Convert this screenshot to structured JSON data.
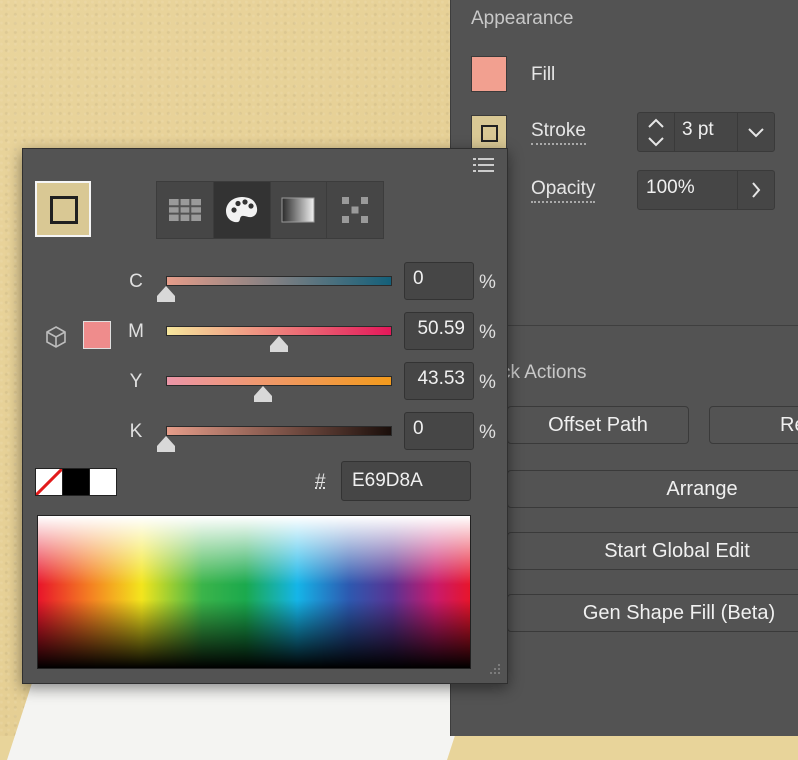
{
  "appearance": {
    "title": "Appearance",
    "fill_label": "Fill",
    "stroke_label": "Stroke",
    "stroke_weight": "3 pt",
    "opacity_label": "Opacity",
    "opacity_value": "100%"
  },
  "quick_actions": {
    "title_partial": "ck Actions",
    "offset_path": "Offset Path",
    "partial_button": "Re",
    "arrange": "Arrange",
    "start_global_edit": "Start Global Edit",
    "gen_shape_fill": "Gen Shape Fill (Beta)"
  },
  "color_picker": {
    "channels": [
      {
        "label": "C",
        "value": "0",
        "unit": "%",
        "level": 0
      },
      {
        "label": "M",
        "value": "50.59",
        "unit": "%",
        "level": 0.5059
      },
      {
        "label": "Y",
        "value": "43.53",
        "unit": "%",
        "level": 0.4353
      },
      {
        "label": "K",
        "value": "0",
        "unit": "%",
        "level": 0
      }
    ],
    "hash_label": "#",
    "hex_value": "E69D8A",
    "modes": [
      "swatches-grid-icon",
      "color-palette-icon",
      "gradient-icon",
      "pattern-icon"
    ],
    "active_mode": "color-palette-icon"
  },
  "colors": {
    "fill": "#E69D8A",
    "stroke_swatch": "#D9C894",
    "panel_bg": "#535353"
  }
}
